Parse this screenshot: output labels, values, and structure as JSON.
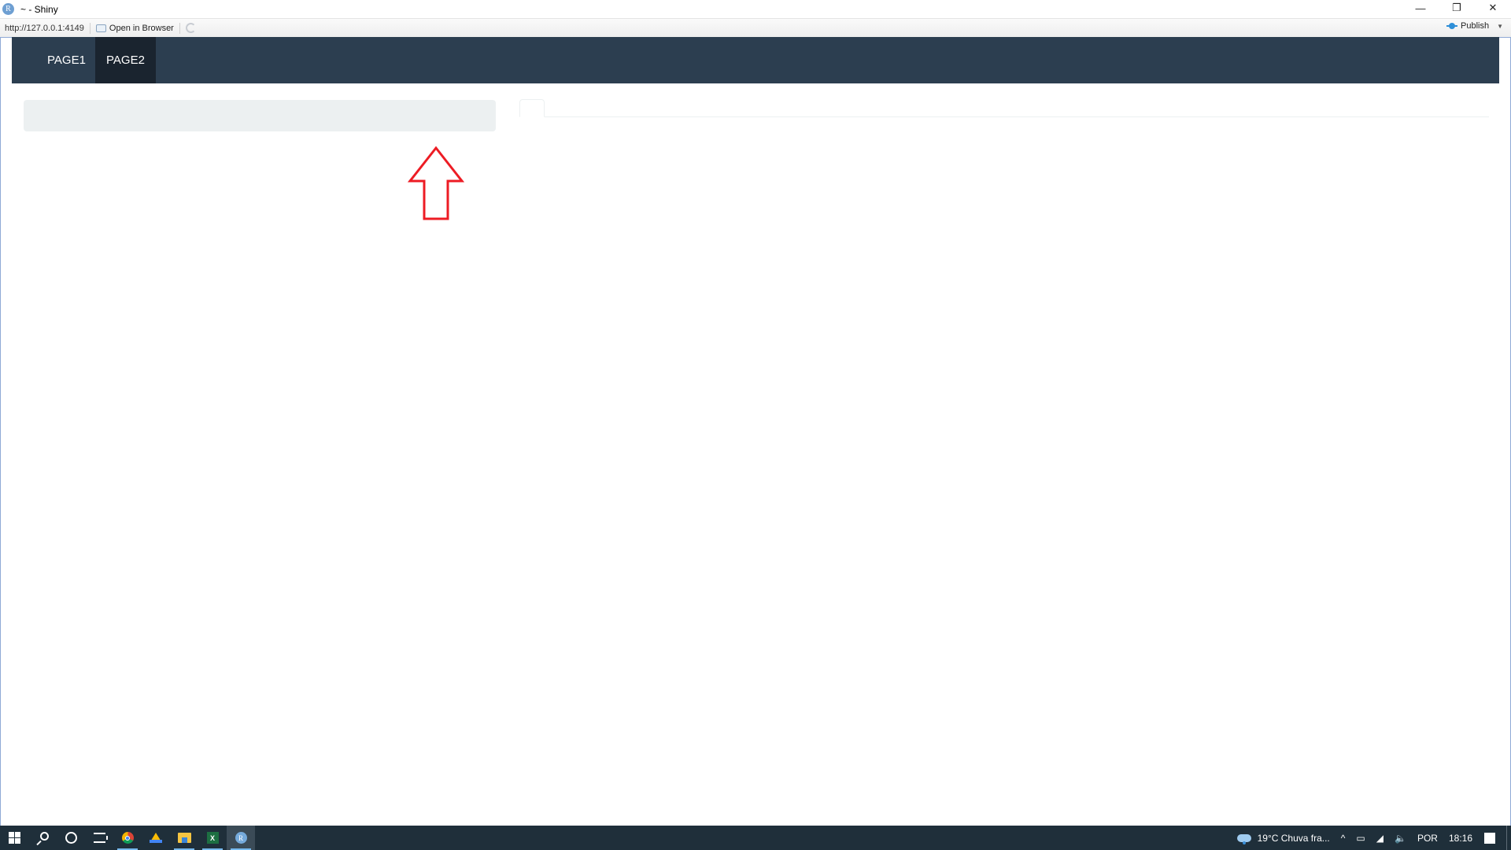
{
  "window": {
    "title": "~ - Shiny",
    "app_icon_letter": "R",
    "controls": {
      "minimize": "—",
      "restore": "❐",
      "close": "✕"
    }
  },
  "addressbar": {
    "url": "http://127.0.0.1:4149",
    "open_in_browser_label": "Open in Browser",
    "publish_label": "Publish",
    "publish_caret": "▼"
  },
  "navbar": {
    "items": [
      {
        "label": "PAGE1",
        "active": false
      },
      {
        "label": "PAGE2",
        "active": true
      }
    ]
  },
  "colors": {
    "navbar_bg": "#2c3e50",
    "navbar_active_bg": "#1a242f",
    "well_bg": "#ecf0f1",
    "annotation_arrow": "#ed1c24",
    "taskbar_bg": "#1f2f3a"
  },
  "annotation": {
    "type": "arrow-up",
    "target": "sidebar-well"
  },
  "taskbar": {
    "apps": [
      {
        "name": "start",
        "icon": "windows-icon"
      },
      {
        "name": "search",
        "icon": "search-icon"
      },
      {
        "name": "cortana",
        "icon": "cortana-icon"
      },
      {
        "name": "task-view",
        "icon": "task-view-icon"
      },
      {
        "name": "chrome",
        "icon": "chrome-icon"
      },
      {
        "name": "google-drive",
        "icon": "google-drive-icon"
      },
      {
        "name": "file-explorer",
        "icon": "folder-icon"
      },
      {
        "name": "excel",
        "icon": "excel-icon",
        "letter": "X"
      },
      {
        "name": "rstudio",
        "icon": "rstudio-icon",
        "letter": "R"
      }
    ],
    "tray": {
      "weather": "19°C  Chuva fra...",
      "chevron": "^",
      "language": "POR",
      "time": "18:16"
    }
  }
}
